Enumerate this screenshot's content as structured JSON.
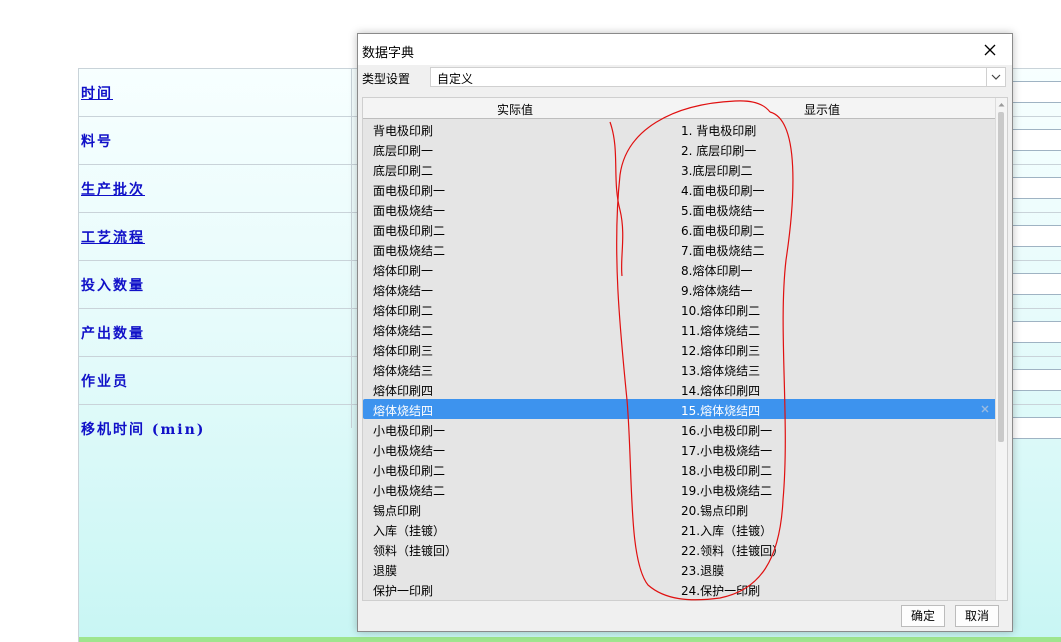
{
  "background_form": {
    "labels": [
      {
        "text": "时间",
        "underline": true
      },
      {
        "text": "料号",
        "underline": false
      },
      {
        "text": "生产批次",
        "underline": true
      },
      {
        "text": "工艺流程",
        "underline": true
      },
      {
        "text": "投入数量",
        "underline": false
      },
      {
        "text": "产出数量",
        "underline": false
      },
      {
        "text": "作业员",
        "underline": false
      },
      {
        "text": "移机时间 (min)",
        "underline": false
      }
    ]
  },
  "dialog": {
    "title": "数据字典",
    "type_label": "类型设置",
    "type_value": "自定义",
    "columns": {
      "actual": "实际值",
      "display": "显示值"
    },
    "rows": [
      {
        "actual": "背电极印刷",
        "display": "1. 背电极印刷"
      },
      {
        "actual": "底层印刷一",
        "display": "2. 底层印刷一"
      },
      {
        "actual": "底层印刷二",
        "display": "3.底层印刷二"
      },
      {
        "actual": "面电极印刷一",
        "display": "4.面电极印刷一"
      },
      {
        "actual": "面电极烧结一",
        "display": "5.面电极烧结一"
      },
      {
        "actual": "面电极印刷二",
        "display": "6.面电极印刷二"
      },
      {
        "actual": "面电极烧结二",
        "display": "7.面电极烧结二"
      },
      {
        "actual": "熔体印刷一",
        "display": "8.熔体印刷一"
      },
      {
        "actual": "熔体烧结一",
        "display": "9.熔体烧结一"
      },
      {
        "actual": "熔体印刷二",
        "display": "10.熔体印刷二"
      },
      {
        "actual": "熔体烧结二",
        "display": "11.熔体烧结二"
      },
      {
        "actual": "熔体印刷三",
        "display": "12.熔体印刷三"
      },
      {
        "actual": "熔体烧结三",
        "display": "13.熔体烧结三"
      },
      {
        "actual": "熔体印刷四",
        "display": "14.熔体印刷四"
      },
      {
        "actual": "熔体烧结四",
        "display": "15.熔体烧结四"
      },
      {
        "actual": "小电极印刷一",
        "display": "16.小电极印刷一"
      },
      {
        "actual": "小电极烧结一",
        "display": "17.小电极烧结一"
      },
      {
        "actual": "小电极印刷二",
        "display": "18.小电极印刷二"
      },
      {
        "actual": "小电极烧结二",
        "display": "19.小电极烧结二"
      },
      {
        "actual": "锡点印刷",
        "display": "20.锡点印刷"
      },
      {
        "actual": "入库（挂镀）",
        "display": "21.入库（挂镀）"
      },
      {
        "actual": "领料（挂镀回）",
        "display": "22.领料（挂镀回）"
      },
      {
        "actual": "退膜",
        "display": "23.退膜"
      },
      {
        "actual": "保护一印刷",
        "display": "24.保护一印刷"
      }
    ],
    "selected_index": 14,
    "ok_label": "确定",
    "cancel_label": "取消"
  },
  "colors": {
    "selection": "#3d93ee",
    "label_blue": "#1010c8",
    "annotation_red": "#e01010"
  },
  "icons": {
    "close": "close-icon",
    "dropdown": "chevron-down-icon",
    "row_mark": "remove-row-icon",
    "scroll_up": "scroll-up-icon"
  }
}
